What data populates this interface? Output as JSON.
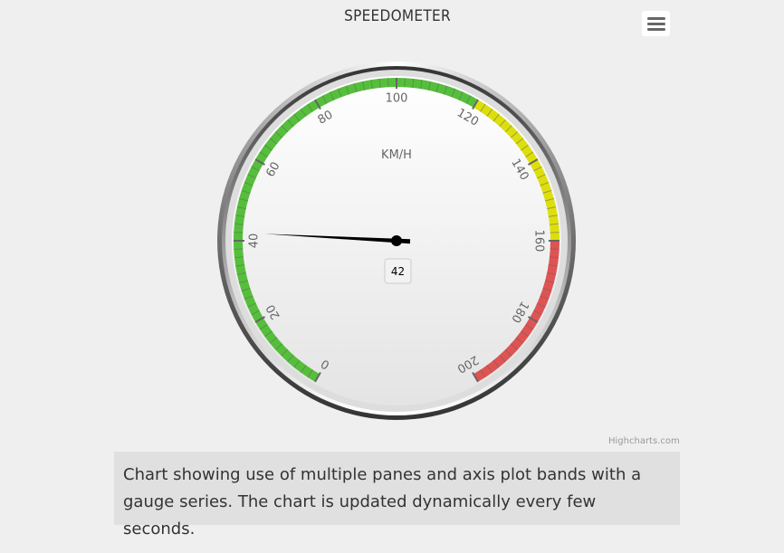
{
  "chart_data": {
    "type": "gauge",
    "title": "SPEEDOMETER",
    "axis": {
      "min": 0,
      "max": 200,
      "start_angle_deg": -150,
      "end_angle_deg": 150,
      "tick_labels": [
        "0",
        "20",
        "40",
        "60",
        "80",
        "100",
        "120",
        "140",
        "160",
        "180",
        "200"
      ],
      "unit_label": "KM/H"
    },
    "plot_bands": [
      {
        "from": 0,
        "to": 120,
        "color": "#55BF3B"
      },
      {
        "from": 120,
        "to": 160,
        "color": "#DDDF0D"
      },
      {
        "from": 160,
        "to": 200,
        "color": "#DF5353"
      }
    ],
    "series": [
      {
        "values": [
          42
        ]
      }
    ],
    "value_label": "42"
  },
  "menu": {
    "icon": "hamburger-icon"
  },
  "credits": "Highcharts.com",
  "caption": "Chart showing use of multiple panes and axis plot bands with a gauge series. The chart is updated dynamically every few seconds."
}
